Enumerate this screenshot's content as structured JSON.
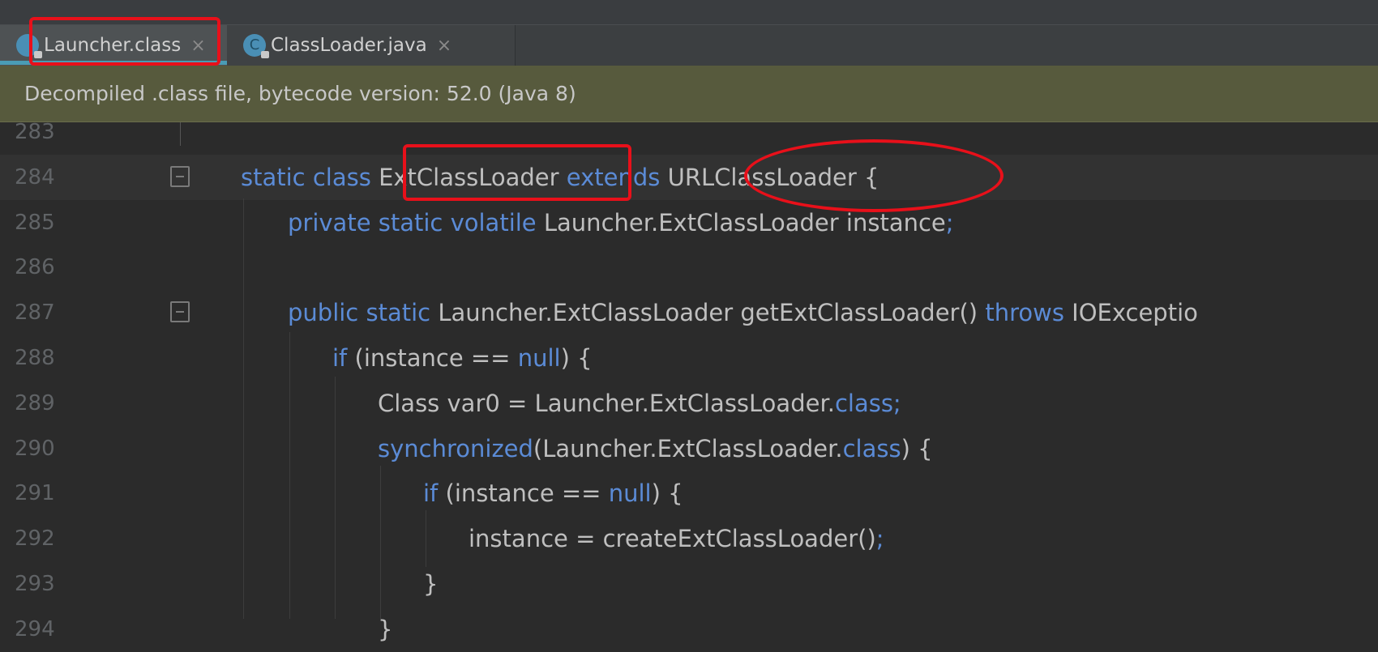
{
  "tabs": [
    {
      "label": "Launcher.class",
      "icon": "class-file-locked-icon",
      "active": true
    },
    {
      "label": "ClassLoader.java",
      "icon": "java-class-locked-icon",
      "active": false
    }
  ],
  "close_glyph": "×",
  "banner": {
    "text": "Decompiled .class file, bytecode version: 52.0 (Java 8)"
  },
  "editor": {
    "lines": [
      {
        "num": "283",
        "parts": []
      },
      {
        "num": "284",
        "parts": [
          [
            "kw",
            "static class "
          ],
          [
            "t",
            "ExtClassLoader "
          ],
          [
            "kw",
            "extends "
          ],
          [
            "t",
            "URLClassLoader {"
          ]
        ]
      },
      {
        "num": "285",
        "parts": [
          [
            "kw",
            "private static volatile "
          ],
          [
            "t",
            "Launcher.ExtClassLoader instance"
          ],
          [
            "kw",
            ";"
          ]
        ]
      },
      {
        "num": "286",
        "parts": []
      },
      {
        "num": "287",
        "parts": [
          [
            "kw",
            "public static "
          ],
          [
            "t",
            "Launcher.ExtClassLoader getExtClassLoader() "
          ],
          [
            "kw",
            "throws "
          ],
          [
            "t",
            "IOExceptio"
          ]
        ]
      },
      {
        "num": "288",
        "parts": [
          [
            "kw",
            "if "
          ],
          [
            "t",
            "(instance == "
          ],
          [
            "kw",
            "null"
          ],
          [
            "t",
            ") {"
          ]
        ]
      },
      {
        "num": "289",
        "parts": [
          [
            "t",
            "Class var0 = Launcher.ExtClassLoader."
          ],
          [
            "kw",
            "class;"
          ]
        ]
      },
      {
        "num": "290",
        "parts": [
          [
            "kw",
            "synchronized"
          ],
          [
            "t",
            "(Launcher.ExtClassLoader."
          ],
          [
            "kw",
            "class"
          ],
          [
            "t",
            ") {"
          ]
        ]
      },
      {
        "num": "291",
        "parts": [
          [
            "kw",
            "if "
          ],
          [
            "t",
            "(instance == "
          ],
          [
            "kw",
            "null"
          ],
          [
            "t",
            ") {"
          ]
        ]
      },
      {
        "num": "292",
        "parts": [
          [
            "t",
            "instance = createExtClassLoader()"
          ],
          [
            "kw",
            ";"
          ]
        ]
      },
      {
        "num": "293",
        "parts": [
          [
            "t",
            "}"
          ]
        ]
      },
      {
        "num": "294",
        "parts": [
          [
            "t",
            "}"
          ]
        ]
      }
    ]
  },
  "colors": {
    "keyword": "#5b8bd6",
    "text": "#bfbfbf",
    "annotation": "#e8101a",
    "banner": "#575a3d"
  }
}
